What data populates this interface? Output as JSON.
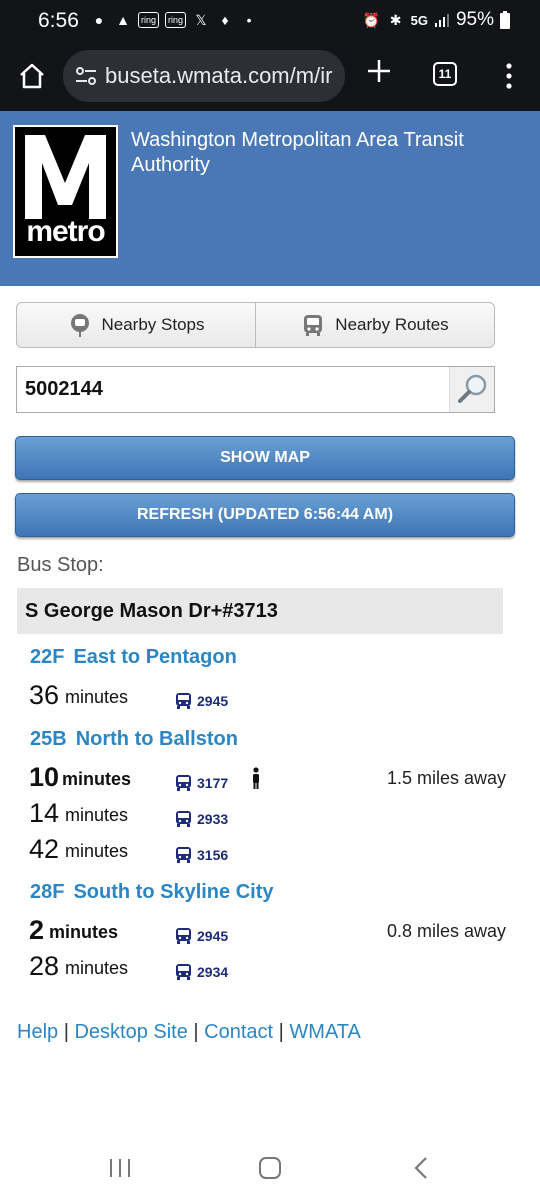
{
  "status_bar": {
    "time": "6:56",
    "ring_a": "ring",
    "ring_b": "ring",
    "network": "5G",
    "battery": "95%"
  },
  "browser": {
    "url": "buseta.wmata.com/m/ir",
    "tab_count": "11"
  },
  "header": {
    "logo_text": "metro",
    "title": "Washington Metropolitan Area Transit Authority"
  },
  "nearby": {
    "stops_label": "Nearby Stops",
    "routes_label": "Nearby Routes"
  },
  "search": {
    "value": "5002144"
  },
  "buttons": {
    "show_map": "SHOW MAP",
    "refresh": "REFRESH (UPDATED 6:56:44 AM)"
  },
  "stop": {
    "label": "Bus Stop:",
    "name": "S George Mason Dr+#3713"
  },
  "routes": [
    {
      "id": "22F",
      "direction": "East to Pentagon",
      "arrivals": [
        {
          "minutes": "36",
          "unit": "minutes",
          "bus": "2945",
          "distance": ""
        }
      ]
    },
    {
      "id": "25B",
      "direction": "North to Ballston",
      "arrivals": [
        {
          "minutes": "10",
          "unit": "minutes",
          "bus": "3177",
          "distance": "1.5 miles away"
        },
        {
          "minutes": "14",
          "unit": "minutes",
          "bus": "2933",
          "distance": ""
        },
        {
          "minutes": "42",
          "unit": "minutes",
          "bus": "3156",
          "distance": ""
        }
      ]
    },
    {
      "id": "28F",
      "direction": "South to Skyline City",
      "arrivals": [
        {
          "minutes": "2",
          "unit": "minutes",
          "bus": "2945",
          "distance": "0.8 miles away"
        },
        {
          "minutes": "28",
          "unit": "minutes",
          "bus": "2934",
          "distance": ""
        }
      ]
    }
  ],
  "footer": {
    "help": "Help",
    "desktop": "Desktop Site",
    "contact": "Contact",
    "wmata": "WMATA",
    "separator": " | "
  }
}
